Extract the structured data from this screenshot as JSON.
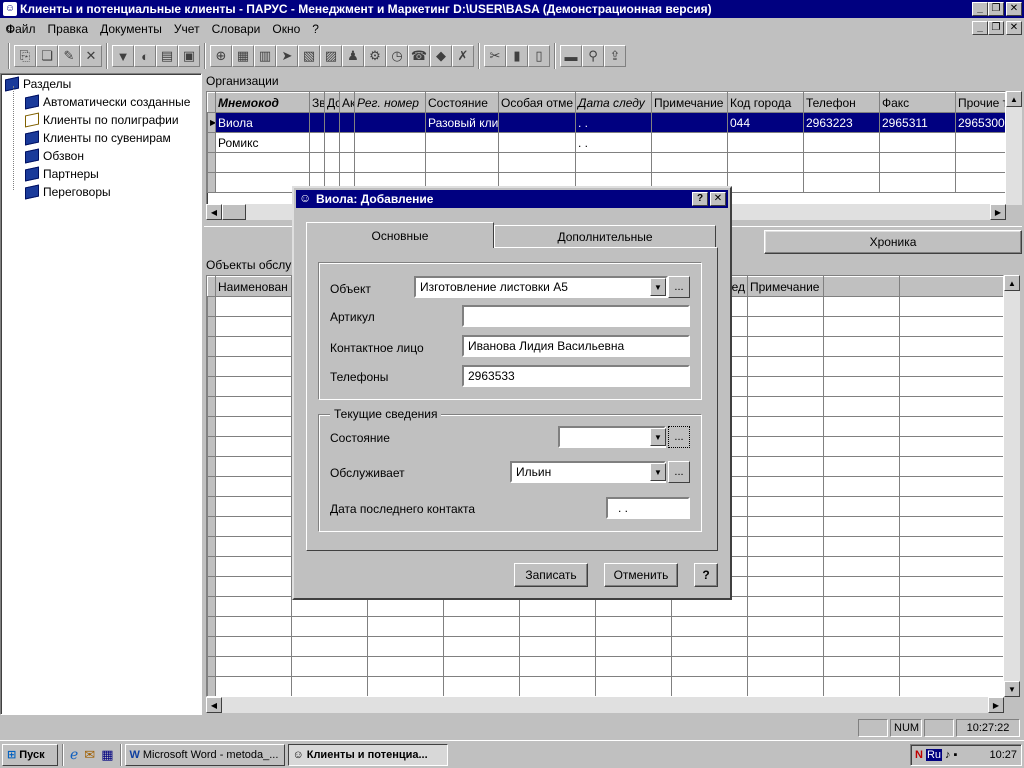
{
  "app": {
    "title": "Клиенты и потенциальные клиенты - ПАРУС - Менеджмент и Маркетинг  D:\\USER\\BASA (Демонстрационная версия)"
  },
  "menu": [
    "Файл",
    "Правка",
    "Документы",
    "Учет",
    "Словари",
    "Окно",
    "?"
  ],
  "toolbar": {
    "icons": [
      "add-icon",
      "copy-icon",
      "edit-icon",
      "delete-icon",
      "filter-icon",
      "filter-clear-icon",
      "print-icon",
      "box-icon",
      "target-icon",
      "doc-icon",
      "doc2-icon",
      "forward-icon",
      "doc3-icon",
      "doc4-icon",
      "person-icon",
      "gear-icon",
      "clock-icon",
      "phone-icon",
      "chart-icon",
      "x-icon",
      "tools-icon",
      "note-icon",
      "page-icon",
      "folder-icon",
      "search-icon",
      "export-icon"
    ]
  },
  "sections": {
    "root_label": "Разделы",
    "items": [
      {
        "label": "Автоматически созданные",
        "icon": "closed-book-icon"
      },
      {
        "label": "Клиенты по полиграфии",
        "icon": "open-book-icon"
      },
      {
        "label": "Клиенты по сувенирам",
        "icon": "closed-book-icon"
      },
      {
        "label": "Обзвон",
        "icon": "closed-book-icon"
      },
      {
        "label": "Партнеры",
        "icon": "closed-book-icon"
      },
      {
        "label": "Переговоры",
        "icon": "closed-book-icon"
      }
    ]
  },
  "organizations": {
    "caption": "Организации",
    "columns": [
      "Мнемокод",
      "Зв",
      "Дс",
      "Ак",
      "Рег. номер",
      "Состояние",
      "Особая отме",
      "Дата следу",
      "Примечание",
      "Код города",
      "Телефон",
      "Факс",
      "Прочие т"
    ],
    "rows": [
      [
        "Виола",
        "",
        "",
        "",
        "",
        "Разовый кли",
        "",
        ". .",
        "",
        "044",
        "2963223",
        "2965311",
        "2965300"
      ],
      [
        "Ромикс",
        "",
        "",
        "",
        "",
        "",
        "",
        ". .",
        "",
        "",
        "",
        "",
        ""
      ]
    ]
  },
  "lower": {
    "tab_right": "Хроника",
    "caption": "Объекты обслу",
    "col_name": "Наименован",
    "col_partial": "ед",
    "col_note": "Примечание"
  },
  "dialog": {
    "title": "Виола: Добавление",
    "help_btn": "?",
    "close_btn": "✕",
    "tabs": [
      "Основные",
      "Дополнительные"
    ],
    "object_label": "Объект",
    "object_value": "Изготовление листовки  А5",
    "article_label": "Артикул",
    "article_value": "",
    "contact_label": "Контактное лицо",
    "contact_value": "Иванова Лидия Васильевна",
    "phones_label": "Телефоны",
    "phones_value": "2963533",
    "group_caption": "Текущие сведения",
    "state_label": "Состояние",
    "state_value": "",
    "serves_label": "Обслуживает",
    "serves_value": "Ильин",
    "last_contact_label": "Дата последнего контакта",
    "last_contact_value": ". .",
    "ellipsis": "...",
    "save_btn": "Записать",
    "cancel_btn": "Отменить",
    "help_btn2": "?"
  },
  "status": {
    "num": "NUM",
    "time": "10:27:22"
  },
  "taskbar": {
    "start": "Пуск",
    "word_task": "Microsoft Word - metoda_...",
    "app_task": "Клиенты и потенциа...",
    "lang": "Ru",
    "clock": "10:27"
  }
}
